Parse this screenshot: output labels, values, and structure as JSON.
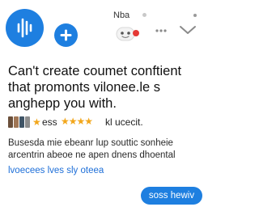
{
  "header": {
    "top_label": "Nba",
    "avatar_icon": "voice-wave-icon",
    "add_icon": "plus-icon",
    "bot_icon": "bot-face-icon",
    "more_icon": "more-dots-icon",
    "collapse_icon": "chevron-down-icon"
  },
  "message": {
    "heading": "Can't create coumet conftient that promonts vilonee.le s anghepp you with.",
    "meta": {
      "prefix": "ess",
      "stars": "★★★★",
      "rating_count": 4,
      "suffix": "kl ucecit."
    },
    "body": "Busesda mie ebeanr lup souttic sonheie arcentrin abeoe ne apen dnens dhoental",
    "link": "lvoecees lves sly oteea"
  },
  "actions": {
    "reply_label": "soss hewiv"
  },
  "colors": {
    "accent": "#1e7fe0",
    "star": "#f2a71c",
    "link": "#1e6fd8",
    "badge_red": "#e53935"
  }
}
